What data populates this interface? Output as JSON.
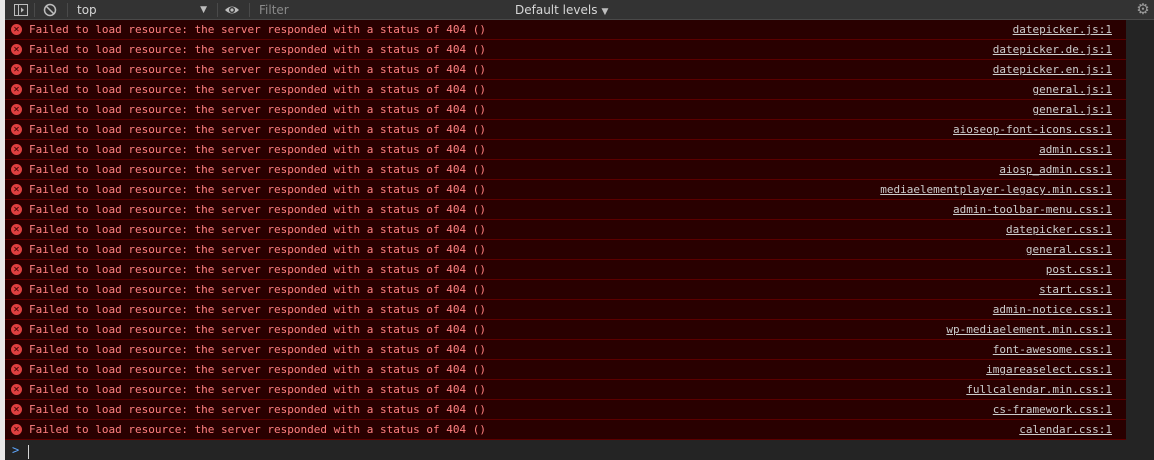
{
  "toolbar": {
    "context": "top",
    "filter_placeholder": "Filter",
    "levels": "Default levels"
  },
  "icons": {
    "sidebar": "sidebar-toggle-icon",
    "clear": "clear-console-icon",
    "eye": "eye-icon",
    "settings": "gear-icon",
    "error": "error-circle-icon",
    "prompt": "chevron-right-icon"
  },
  "colors": {
    "error_text": "#ff8080",
    "error_row_bg": "#290000",
    "error_icon": "#e04040",
    "prompt_accent": "#5fa8ff"
  },
  "messages": [
    {
      "text": "Failed to load resource: the server responded with a status of 404 ()",
      "source": "datepicker.js:1"
    },
    {
      "text": "Failed to load resource: the server responded with a status of 404 ()",
      "source": "datepicker.de.js:1"
    },
    {
      "text": "Failed to load resource: the server responded with a status of 404 ()",
      "source": "datepicker.en.js:1"
    },
    {
      "text": "Failed to load resource: the server responded with a status of 404 ()",
      "source": "general.js:1"
    },
    {
      "text": "Failed to load resource: the server responded with a status of 404 ()",
      "source": "general.js:1"
    },
    {
      "text": "Failed to load resource: the server responded with a status of 404 ()",
      "source": "aioseop-font-icons.css:1"
    },
    {
      "text": "Failed to load resource: the server responded with a status of 404 ()",
      "source": "admin.css:1"
    },
    {
      "text": "Failed to load resource: the server responded with a status of 404 ()",
      "source": "aiosp_admin.css:1"
    },
    {
      "text": "Failed to load resource: the server responded with a status of 404 ()",
      "source": "mediaelementplayer-legacy.min.css:1"
    },
    {
      "text": "Failed to load resource: the server responded with a status of 404 ()",
      "source": "admin-toolbar-menu.css:1"
    },
    {
      "text": "Failed to load resource: the server responded with a status of 404 ()",
      "source": "datepicker.css:1"
    },
    {
      "text": "Failed to load resource: the server responded with a status of 404 ()",
      "source": "general.css:1"
    },
    {
      "text": "Failed to load resource: the server responded with a status of 404 ()",
      "source": "post.css:1"
    },
    {
      "text": "Failed to load resource: the server responded with a status of 404 ()",
      "source": "start.css:1"
    },
    {
      "text": "Failed to load resource: the server responded with a status of 404 ()",
      "source": "admin-notice.css:1"
    },
    {
      "text": "Failed to load resource: the server responded with a status of 404 ()",
      "source": "wp-mediaelement.min.css:1"
    },
    {
      "text": "Failed to load resource: the server responded with a status of 404 ()",
      "source": "font-awesome.css:1"
    },
    {
      "text": "Failed to load resource: the server responded with a status of 404 ()",
      "source": "imgareaselect.css:1"
    },
    {
      "text": "Failed to load resource: the server responded with a status of 404 ()",
      "source": "fullcalendar.min.css:1"
    },
    {
      "text": "Failed to load resource: the server responded with a status of 404 ()",
      "source": "cs-framework.css:1"
    },
    {
      "text": "Failed to load resource: the server responded with a status of 404 ()",
      "source": "calendar.css:1"
    }
  ]
}
